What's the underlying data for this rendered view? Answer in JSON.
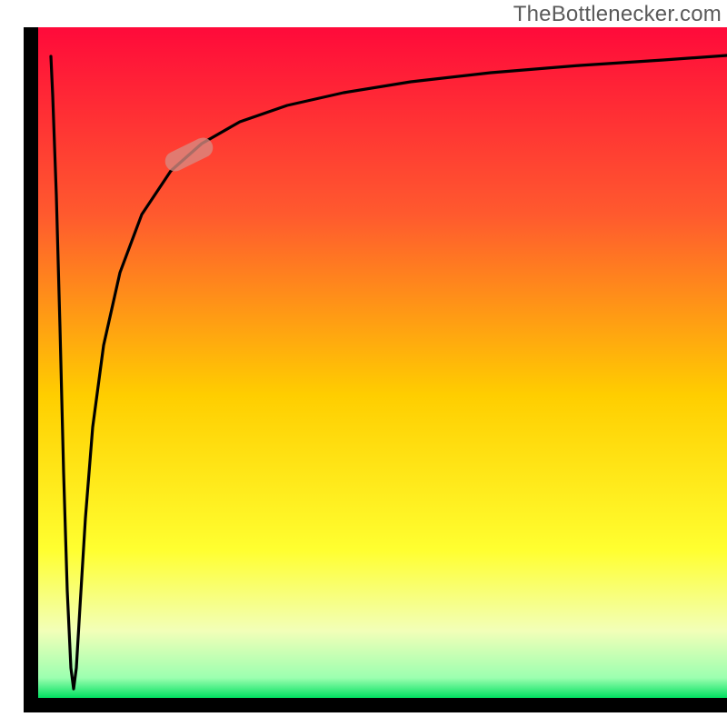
{
  "watermark": "TheBottlenecker.com",
  "chart_data": {
    "type": "line",
    "title": "",
    "xlabel": "",
    "ylabel": "",
    "xlim": [
      0,
      1
    ],
    "ylim": [
      0,
      1
    ],
    "background_gradient": {
      "top": "#ff0a3a",
      "upper_mid": "#ff6a2a",
      "mid": "#ffce00",
      "lower_mid": "#ffff55",
      "near_bottom": "#e9ffc0",
      "bottom": "#00e060"
    },
    "axis_thickness_px": 16,
    "series": [
      {
        "name": "curve-down",
        "x": [
          0.04,
          0.042,
          0.044,
          0.046,
          0.048,
          0.05,
          0.052,
          0.054,
          0.056,
          0.058,
          0.06
        ],
        "y": [
          0.955,
          0.86,
          0.74,
          0.6,
          0.46,
          0.33,
          0.22,
          0.14,
          0.08,
          0.04,
          0.02
        ]
      },
      {
        "name": "curve-up",
        "x": [
          0.06,
          0.063,
          0.068,
          0.075,
          0.085,
          0.1,
          0.12,
          0.15,
          0.19,
          0.24,
          0.3,
          0.38,
          0.48,
          0.6,
          0.74,
          0.88,
          1.0
        ],
        "y": [
          0.02,
          0.15,
          0.3,
          0.45,
          0.58,
          0.68,
          0.75,
          0.805,
          0.845,
          0.875,
          0.895,
          0.912,
          0.926,
          0.938,
          0.949,
          0.957,
          0.963
        ]
      }
    ],
    "marker": {
      "name": "highlight-pill",
      "x_center": 0.225,
      "y_center": 0.862,
      "angle_deg": 26,
      "length": 0.065,
      "thickness": 0.024,
      "color": "#d98a82",
      "opacity": 0.78
    }
  }
}
